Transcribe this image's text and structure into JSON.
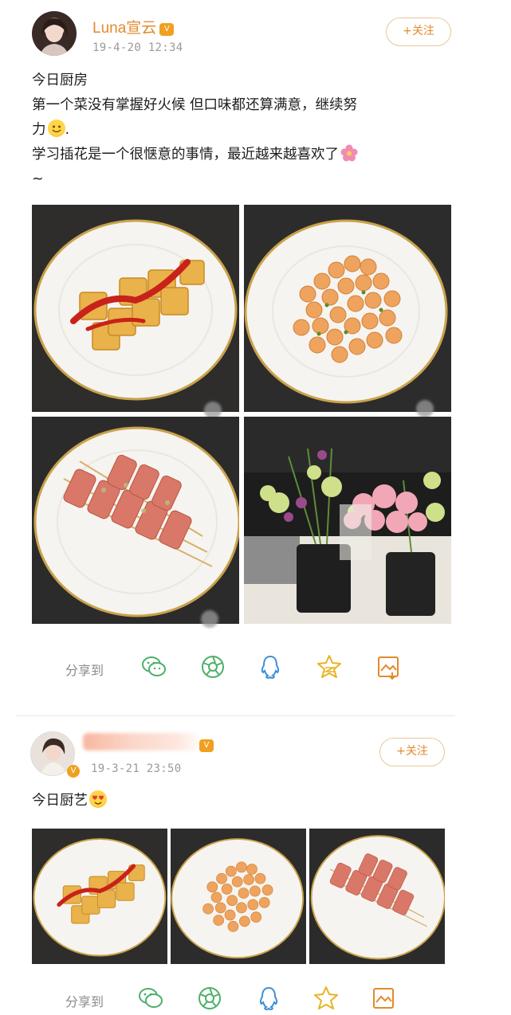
{
  "post1": {
    "username": "Luna宣云",
    "timestamp": "19-4-20 12:34",
    "follow_label": "+关注",
    "text_lines": [
      "今日厨房",
      "第一个菜没有掌握好火候 但口味都还算满意，继续努",
      "力",
      "学习插花是一个很惬意的事情，最近越来越喜欢了",
      "~"
    ],
    "text_after_emoji": ".",
    "photos": [
      "omelet-roll-with-ketchup",
      "shrimp-dish",
      "bacon-skewers",
      "flower-vases"
    ],
    "share_label": "分享到"
  },
  "post2": {
    "timestamp": "19-3-21 23:50",
    "follow_label": "+关注",
    "text": "今日厨艺",
    "photos": [
      "omelet-roll-with-ketchup",
      "shrimp-dish",
      "bacon-skewers"
    ],
    "share_label": "分享到"
  },
  "share_icons": [
    "wechat-icon",
    "moments-icon",
    "qq-icon",
    "qzone-icon",
    "save-image-icon"
  ],
  "colors": {
    "accent": "#e38a2b",
    "follow_border": "#e8c89a",
    "share_icon": "#4db06a",
    "plate_rim": "#c9a24a"
  }
}
